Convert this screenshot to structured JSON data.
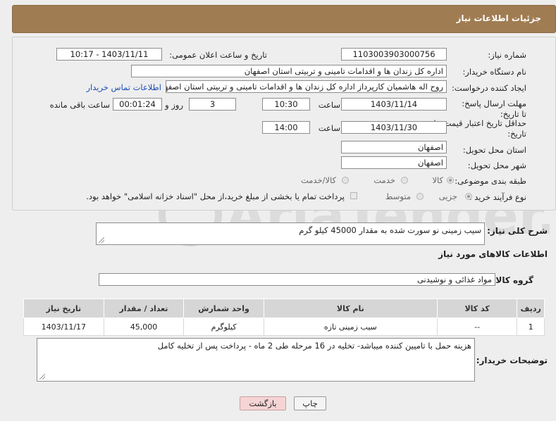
{
  "header": {
    "title": "جزئیات اطلاعات نیاز"
  },
  "fields": {
    "need_number_label": "شماره نیاز:",
    "need_number": "1103003903000756",
    "announce_label": "تاریخ و ساعت اعلان عمومی:",
    "announce_value": "1403/11/11 - 10:17",
    "buyer_label": "نام دستگاه خریدار:",
    "buyer_value": "اداره کل زندان ها و اقدامات تامینی و تربیتی استان اصفهان",
    "creator_label": "ایجاد کننده درخواست:",
    "creator_value": "روح اله هاشمیان کارپرداز اداره کل زندان ها و اقدامات تامینی و تربیتی استان اصفهان",
    "contact_link": "اطلاعات تماس خریدار",
    "deadline_label": "مهلت ارسال پاسخ: تا تاریخ:",
    "deadline_date": "1403/11/14",
    "time_label": "ساعت",
    "deadline_time": "10:30",
    "days_value": "3",
    "days_label": "روز و",
    "remaining_time": "00:01:24",
    "remaining_label": "ساعت باقی مانده",
    "validity_label": "حداقل تاریخ اعتبار قیمت: تا تاریخ:",
    "validity_date": "1403/11/30",
    "validity_time": "14:00",
    "province_label": "استان محل تحویل:",
    "province_value": "اصفهان",
    "city_label": "شهر محل تحویل:",
    "city_value": "اصفهان",
    "category_label": "طبقه بندی موضوعی:",
    "category_options": [
      "کالا",
      "خدمت",
      "کالا/خدمت"
    ],
    "category_selected": 0,
    "purchase_label": "نوع فرآیند خرید :",
    "purchase_options": [
      "جزیی",
      "متوسط"
    ],
    "purchase_selected": 0,
    "payment_note": "پرداخت تمام یا بخشی از مبلغ خرید،از محل \"اسناد خزانه اسلامی\" خواهد بود."
  },
  "description": {
    "label": "شرح کلی نیاز:",
    "value": "سیب زمینی نو سورت شده به مقدار 45000 کیلو گرم"
  },
  "goods_info_title": "اطلاعات کالاهای مورد نیاز",
  "goods_group": {
    "label": "گروه کالا:",
    "value": "مواد غذائی و نوشیدنی"
  },
  "table": {
    "headers": [
      "ردیف",
      "کد کالا",
      "نام کالا",
      "واحد شمارش",
      "تعداد / مقدار",
      "تاریخ نیاز"
    ],
    "rows": [
      [
        "1",
        "--",
        "سیب زمینی تازه",
        "کیلوگرم",
        "45,000",
        "1403/11/17"
      ]
    ]
  },
  "buyer_notes": {
    "label": "توضیحات خریدار:",
    "value": "هزینه حمل با تامیین کننده میباشد- تخلیه در 16 مرحله طی 2 ماه - پرداخت پس از تخلیه کامل"
  },
  "buttons": {
    "print": "چاپ",
    "back": "بازگشت"
  },
  "colors": {
    "header": "#a07c52",
    "back_button": "#f5d4d4",
    "link": "#1a4fb5"
  }
}
